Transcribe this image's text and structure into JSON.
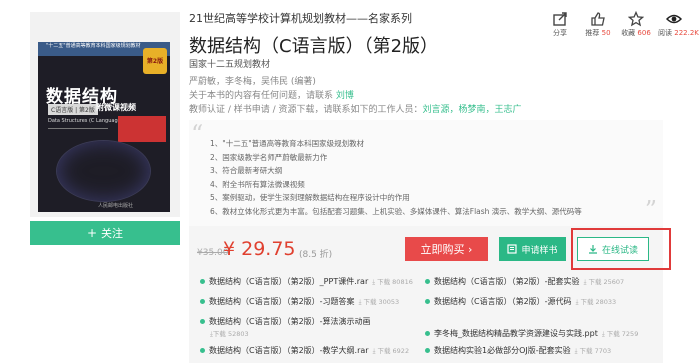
{
  "cover": {
    "title": "数据结构",
    "edition_tag": "C语言版 | 第2版",
    "video_tag": "附微课视频",
    "en_title": "Data Structures (C Language Edition)",
    "top_band": "\"十二五\"普通高等教育本科国家级规划教材",
    "badge": "第2版",
    "publisher": "人民邮电出版社"
  },
  "follow_button": {
    "plus": "+",
    "label": "关注"
  },
  "series": "21世纪高等学校计算机规划教材——名家系列",
  "title": "数据结构（C语言版）（第2版）",
  "national": "国家十二五规划教材",
  "actions": [
    {
      "icon": "share-icon",
      "label": "分享",
      "value": ""
    },
    {
      "icon": "thumbs-up-icon",
      "label": "推荐",
      "value": "50"
    },
    {
      "icon": "star-icon",
      "label": "收藏",
      "value": "606"
    },
    {
      "icon": "eye-icon",
      "label": "阅读",
      "value": "222.2K"
    }
  ],
  "authors": "严蔚敏，李冬梅，吴伟民 (编著)",
  "contact": {
    "text": "关于本书的内容有任何问题，请联系 ",
    "name": "刘博"
  },
  "workers": {
    "text": "教师认证 / 样书申请 / 资源下载，请联系如下的工作人员：",
    "names": "刘言源，杨梦南，王志广"
  },
  "features": [
    "1、\"十二五\"普通高等教育本科国家级规划教材",
    "2、国家级教学名师严蔚敏最新力作",
    "3、符合最新考研大纲",
    "4、附全书所有算法微课视频",
    "5、案例驱动，使学生深刻理解数据结构在程序设计中的作用",
    "6、教材立体化形式更为丰富。包括配套习题集、上机实验、多媒体课件、算法Flash 演示、教学大纲、源代码等"
  ],
  "pricing": {
    "old_price": "¥35.00",
    "new_price": "¥ 29.75",
    "discount": "(8.5 折)"
  },
  "buttons": {
    "buy": "立即购买 ›",
    "sample": "申请样书",
    "read": "在线试读"
  },
  "files": [
    {
      "name": "数据结构（C语言版）（第2版）_PPT课件.rar",
      "downloads": "下载 80816"
    },
    {
      "name": "数据结构（C语言版）（第2版）-配套实验",
      "downloads": "下载 25607"
    },
    {
      "name": "数据结构（C语言版）（第2版）-习题答案",
      "downloads": "下载 30053"
    },
    {
      "name": "数据结构（C语言版）（第2版）-源代码",
      "downloads": "下载 28033"
    },
    {
      "name": "数据结构（C语言版）（第2版）-算法演示动画",
      "downloads": "下载 52803"
    },
    {
      "name": "李冬梅_数据结构精品教学资源建设与实践.ppt",
      "downloads": "下载 7259"
    },
    {
      "name": "数据结构（C语言版）（第2版）-教学大纲.rar",
      "downloads": "下载 6922"
    },
    {
      "name": "数据结构实验1必做部分OJ版-配套实验",
      "downloads": "下载 7703"
    }
  ],
  "colors": {
    "accent": "#37bf8e",
    "price": "#e0402f",
    "buy": "#e84a4a",
    "highlight": "#e03a3a"
  }
}
